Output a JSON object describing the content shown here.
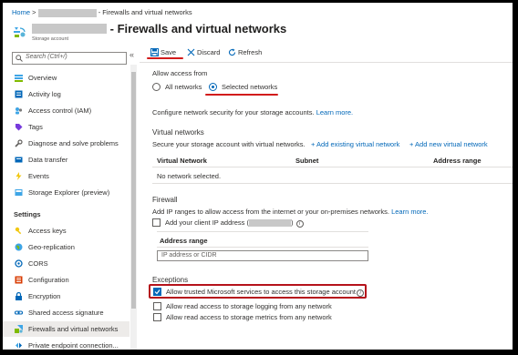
{
  "breadcrumb": {
    "home": "Home",
    "separator": ">",
    "current": "- Firewalls and virtual networks"
  },
  "header": {
    "title": "- Firewalls and virtual networks",
    "subtitle": "Storage account"
  },
  "search": {
    "placeholder": "Search (Ctrl+/)"
  },
  "sidebar": {
    "items": [
      {
        "label": "Overview",
        "icon": "overview-icon"
      },
      {
        "label": "Activity log",
        "icon": "activity-log-icon"
      },
      {
        "label": "Access control (IAM)",
        "icon": "iam-icon"
      },
      {
        "label": "Tags",
        "icon": "tag-icon"
      },
      {
        "label": "Diagnose and solve problems",
        "icon": "wrench-icon"
      },
      {
        "label": "Data transfer",
        "icon": "data-transfer-icon"
      },
      {
        "label": "Events",
        "icon": "lightning-icon"
      },
      {
        "label": "Storage Explorer (preview)",
        "icon": "storage-explorer-icon"
      }
    ],
    "settings_label": "Settings",
    "settings_items": [
      {
        "label": "Access keys",
        "icon": "key-icon"
      },
      {
        "label": "Geo-replication",
        "icon": "globe-icon"
      },
      {
        "label": "CORS",
        "icon": "cors-icon"
      },
      {
        "label": "Configuration",
        "icon": "configuration-icon"
      },
      {
        "label": "Encryption",
        "icon": "lock-icon"
      },
      {
        "label": "Shared access signature",
        "icon": "link-icon"
      },
      {
        "label": "Firewalls and virtual networks",
        "icon": "firewall-icon",
        "selected": true
      },
      {
        "label": "Private endpoint connection...",
        "icon": "private-endpoint-icon"
      }
    ]
  },
  "toolbar": {
    "save": "Save",
    "discard": "Discard",
    "refresh": "Refresh"
  },
  "allow_access": {
    "label": "Allow access from",
    "options": [
      "All networks",
      "Selected networks"
    ],
    "selected": "Selected networks",
    "description": "Configure network security for your storage accounts.",
    "learn_more": "Learn more."
  },
  "virtual_networks": {
    "title": "Virtual networks",
    "description": "Secure your storage account with virtual networks.",
    "add_existing": "+ Add existing virtual network",
    "add_new": "+ Add new virtual network",
    "columns": [
      "Virtual Network",
      "Subnet",
      "Address range"
    ],
    "empty": "No network selected."
  },
  "firewall": {
    "title": "Firewall",
    "description": "Add IP ranges to allow access from the internet or your on-premises networks.",
    "learn_more": "Learn more.",
    "client_ip_label": "Add your client IP address (",
    "client_ip_close": ")",
    "client_ip_checked": false,
    "address_range_label": "Address range",
    "address_placeholder": "IP address or CIDR"
  },
  "exceptions": {
    "title": "Exceptions",
    "items": [
      {
        "label": "Allow trusted Microsoft services to access this storage account",
        "checked": true
      },
      {
        "label": "Allow read access to storage logging from any network",
        "checked": false
      },
      {
        "label": "Allow read access to storage metrics from any network",
        "checked": false
      }
    ]
  },
  "colors": {
    "accent": "#0067b8",
    "highlight_red": "#d21b1b",
    "selected_nav": "#edebe9"
  }
}
